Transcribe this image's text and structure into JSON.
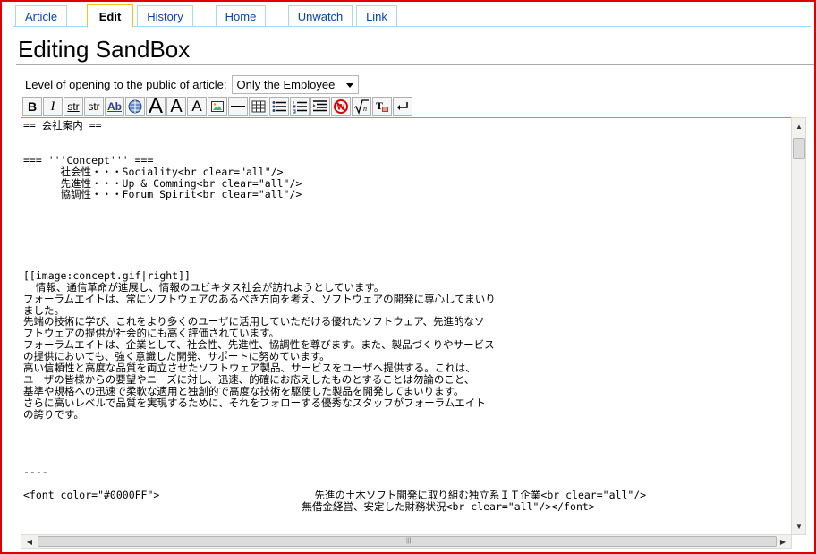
{
  "tabs": [
    {
      "label": "Article"
    },
    {
      "label": "Edit"
    },
    {
      "label": "History"
    },
    {
      "label": "Home"
    },
    {
      "label": "Unwatch"
    },
    {
      "label": "Link"
    }
  ],
  "page_title": "Editing SandBox",
  "opening": {
    "label": "Level of opening to the public of article:",
    "selected": "Only the Employee"
  },
  "toolbar": {
    "bold": "B",
    "italic": "I",
    "strike": "str",
    "strike2": "str",
    "ab": "Ab",
    "font_large": "A",
    "font_medium": "A",
    "font_small": "A"
  },
  "editor_text": "== 会社案内 ==\n\n\n=== '''Concept''' ===\n      社会性・・・Sociality<br clear=\"all\"/>\n      先進性・・・Up & Comming<br clear=\"all\"/>\n      協調性・・・Forum Spirit<br clear=\"all\"/>\n\n\n\n\n\n\n[[image:concept.gif|right]]\n  情報、通信革命が進展し、情報のユビキタス社会が訪れようとしています。\nフォーラムエイトは、常にソフトウェアのあるべき方向を考え、ソフトウェアの開発に専心してまいり\nました。\n先端の技術に学び、これをより多くのユーザに活用していただける優れたソフトウェア、先進的なソ\nフトウェアの提供が社会的にも高く評価されています。\nフォーラムエイトは、企業として、社会性、先進性、協調性を尊びます。また、製品づくりやサービス\nの提供においても、強く意識した開発、サポートに努めています。\n高い信頼性と高度な品質を両立させたソフトウェア製品、サービスをユーザへ提供する。これは、\nユーザの皆様からの要望やニーズに対し、迅速、的確にお応えしたものとすることは勿論のこと、\n基準や規格への迅速で柔軟な適用と独創的で高度な技術を駆使した製品を開発してまいります。\nさらに高いレベルで品質を実現するために、それをフォローする優秀なスタッフがフォーラムエイト\nの誇りです。\n\n\n\n\n----\n\n<font color=\"#0000FF\">                         先進の土木ソフト開発に取り組む独立系ＩＴ企業<br clear=\"all\"/>\n                                             無借金経営、安定した財務状況<br clear=\"all\"/></font>",
  "colors": {
    "tab_border": "#a7d7f9",
    "active_tab_border": "#fabd23",
    "link": "#0645ad",
    "frame": "#e00000"
  }
}
